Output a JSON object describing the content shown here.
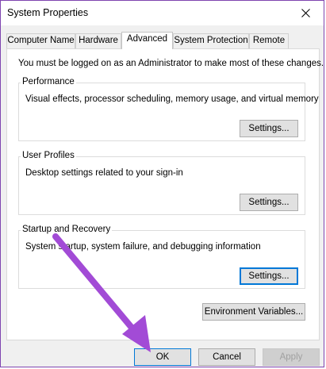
{
  "window": {
    "title": "System Properties",
    "close_glyph": "✕"
  },
  "tabs": [
    {
      "label": "Computer Name",
      "active": false
    },
    {
      "label": "Hardware",
      "active": false
    },
    {
      "label": "Advanced",
      "active": true
    },
    {
      "label": "System Protection",
      "active": false
    },
    {
      "label": "Remote",
      "active": false
    }
  ],
  "advanced": {
    "admin_note": "You must be logged on as an Administrator to make most of these changes.",
    "performance": {
      "title": "Performance",
      "description": "Visual effects, processor scheduling, memory usage, and virtual memory",
      "settings_label": "Settings..."
    },
    "user_profiles": {
      "title": "User Profiles",
      "description": "Desktop settings related to your sign-in",
      "settings_label": "Settings..."
    },
    "startup_recovery": {
      "title": "Startup and Recovery",
      "description": "System startup, system failure, and debugging information",
      "settings_label": "Settings..."
    },
    "env_vars_label": "Environment Variables..."
  },
  "footer": {
    "ok_label": "OK",
    "cancel_label": "Cancel",
    "apply_label": "Apply"
  },
  "colors": {
    "annotation_arrow": "#a24bd6",
    "window_border": "#7f45b0",
    "focus_blue": "#0078d7"
  },
  "icons": {
    "close": "close-icon",
    "overlay": "annotation-arrow"
  }
}
